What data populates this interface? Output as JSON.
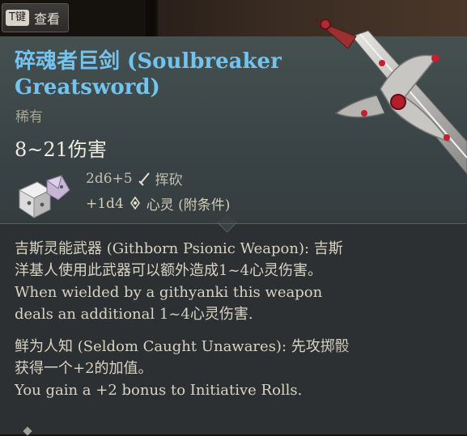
{
  "hint": {
    "key": "T键",
    "label": "查看"
  },
  "item": {
    "name": "碎魂者巨剑 (Soulbreaker Greatsword)",
    "rarity": "稀有",
    "damage_range": "8~21伤害",
    "damage_rolls": [
      {
        "dice": "2d6+5",
        "type": "挥砍",
        "icon": "sword-slash-icon"
      },
      {
        "dice": "+1d4",
        "type": "心灵 (附条件)",
        "icon": "psychic-icon"
      }
    ],
    "name_color": "#73c3ee"
  },
  "traits": [
    {
      "line1": "吉斯灵能武器 (Githborn Psionic Weapon): 吉斯",
      "line2": "洋基人使用此武器可以额外造成1~4心灵伤害。",
      "line3": "When wielded by a githyanki this weapon",
      "line4": "deals an additional 1~4心灵伤害."
    },
    {
      "line1": "鲜为人知 (Seldom Caught Unawares): 先攻掷骰",
      "line2": "获得一个+2的加值。",
      "line3": "You gain a +2 bonus to Initiative Rolls."
    }
  ]
}
